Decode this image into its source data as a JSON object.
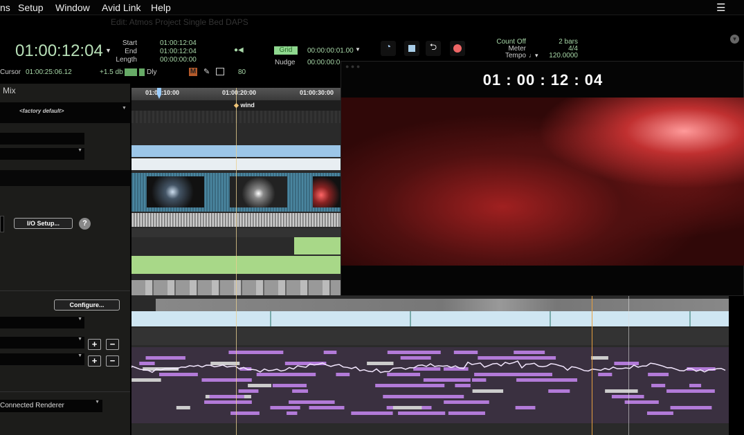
{
  "menu": [
    "ns",
    "Setup",
    "Window",
    "Avid Link",
    "Help"
  ],
  "window_title": "Edit: Atmos Project Single Bed DAPS",
  "counter": {
    "main": "01:00:12:04",
    "start_label": "Start",
    "end_label": "End",
    "length_label": "Length",
    "start": "01:00:12:04",
    "end": "01:00:12:04",
    "length": "00:00:00:00",
    "cursor_label": "Cursor",
    "cursor": "01:00:25:06.12"
  },
  "grid": {
    "label": "Grid",
    "value": "00:00:00:01.00",
    "nudge_label": "Nudge",
    "nudge": "00:00:00:0"
  },
  "toolbar": {
    "gain": "+1.5 db",
    "dly": "Dly",
    "m": "M",
    "zoom": "80"
  },
  "transport": {
    "count_off_label": "Count Off",
    "count_off": "2 bars",
    "meter_label": "Meter",
    "meter": "4/4",
    "tempo_label": "Tempo",
    "tempo": "120.0000"
  },
  "panel": {
    "title": "Mix",
    "preset": "<factory default>",
    "io_setup": "I/O Setup...",
    "help": "?",
    "configure": "Configure...",
    "renderer": "Connected Renderer"
  },
  "ruler": [
    "01:00:10:00",
    "01:00:20:00",
    "01:00:30:00"
  ],
  "marker": "wind",
  "video": {
    "timecode": "01 : 00 : 12 : 04"
  }
}
